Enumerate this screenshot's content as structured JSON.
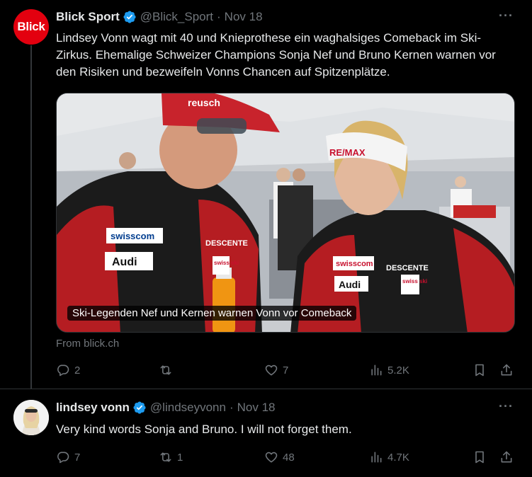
{
  "tweets": [
    {
      "author": "Blick Sport",
      "handle": "@Blick_Sport",
      "date": "Nov 18",
      "avatar_text": "Blick",
      "text": "Lindsey Vonn wagt mit 40 und Knieprothese ein waghalsiges Comeback im Ski-Zirkus. Ehemalige Schweizer Champions Sonja Nef und Bruno Kernen warnen vor den Risiken und bezweifeln Vonns Chancen auf Spitzenplätze.",
      "card": {
        "caption": "Ski-Legenden Nef und Kernen warnen Vonn vor Comeback",
        "source": "From blick.ch",
        "image_texts": [
          "reusch",
          "swisscom",
          "Audi",
          "DESCENTE",
          "RE/MAX",
          "swisscom",
          "Audi",
          "DESCENTE",
          "swiss ski",
          "swiss ski"
        ]
      },
      "stats": {
        "replies": "2",
        "reposts": "",
        "likes": "7",
        "views": "5.2K"
      }
    },
    {
      "author": "lindsey vonn",
      "handle": "@lindseyvonn",
      "date": "Nov 18",
      "text": "Very kind words Sonja and Bruno. I will not forget them.",
      "stats": {
        "replies": "7",
        "reposts": "1",
        "likes": "48",
        "views": "4.7K"
      }
    }
  ],
  "separator": "·",
  "more_icon": "more-horizontal-icon",
  "colors": {
    "background": "#000000",
    "text": "#e7e9ea",
    "muted": "#71767b",
    "verified": "#1d9bf0",
    "blick_red": "#e3000f",
    "divider": "#2f3336"
  }
}
